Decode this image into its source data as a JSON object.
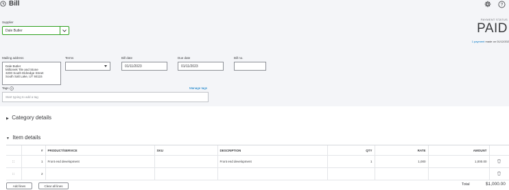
{
  "header": {
    "title": "Bill"
  },
  "supplier": {
    "label": "Supplier",
    "value": "Dale Butler"
  },
  "payment": {
    "status_label": "PAYMENT STATUS",
    "status": "PAID",
    "link_text": "1 payment",
    "made_on": "made on 01/12/202"
  },
  "form": {
    "mailing_label": "Mailing address",
    "mailing_lines": [
      "Dale Butler",
      "Millcreek Tile and Stone",
      "3200 South Eldredge Street",
      "South Salt Lake, UT 84115"
    ],
    "terms_label": "Terms",
    "terms_value": "",
    "bill_date_label": "Bill date",
    "bill_date_value": "01/11/2023",
    "due_date_label": "Due date",
    "due_date_value": "01/11/2023",
    "bill_no_label": "Bill no.",
    "bill_no_value": "",
    "tags_label": "Tags",
    "manage_tags": "Manage tags",
    "tags_placeholder": "Start typing to add a tag"
  },
  "sections": {
    "category": "Category details",
    "items": "Item details"
  },
  "table": {
    "headers": {
      "num": "#",
      "product": "PRODUCT/SERVICE",
      "sku": "SKU",
      "description": "DESCRIPTION",
      "qty": "QTY",
      "rate": "RATE",
      "amount": "AMOUNT"
    },
    "rows": [
      {
        "num": "1",
        "product": "Front end development",
        "sku": "",
        "description": "Front end development",
        "qty": "1",
        "rate": "1,000",
        "amount": "1,000.00"
      },
      {
        "num": "2",
        "product": "",
        "sku": "",
        "description": "",
        "qty": "",
        "rate": "",
        "amount": ""
      }
    ]
  },
  "buttons": {
    "add_lines": "Add lines",
    "clear_all": "Clear all lines"
  },
  "total": {
    "label": "Total",
    "value": "$1,000.00"
  },
  "colors": {
    "accent_green": "#2ca01c",
    "link_blue": "#0077c5",
    "header_bg": "#f4f5f8"
  }
}
